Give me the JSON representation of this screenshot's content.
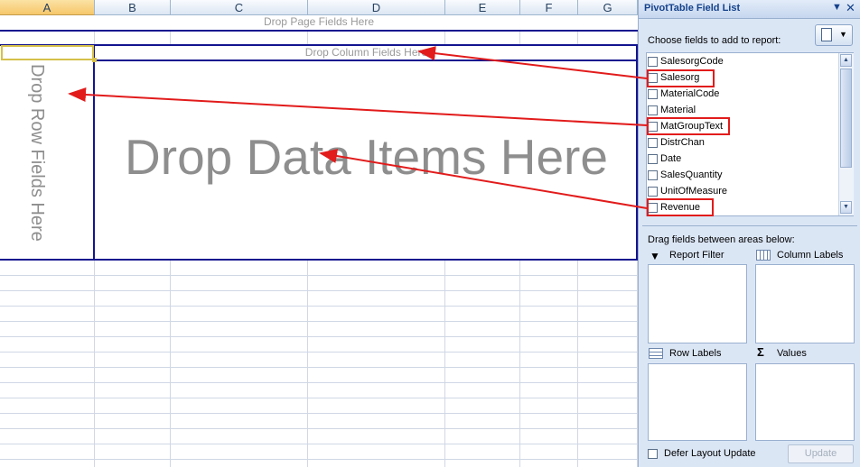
{
  "sheet": {
    "columns": [
      "A",
      "B",
      "C",
      "D",
      "E",
      "F",
      "G"
    ],
    "drop_page": "Drop Page Fields Here",
    "drop_column": "Drop Column Fields Here",
    "drop_row": "Drop Row Fields Here",
    "drop_data": "Drop Data Items Here"
  },
  "pane": {
    "title": "PivotTable Field List",
    "choose_label": "Choose fields to add to report:",
    "fields": [
      "SalesorgCode",
      "Salesorg",
      "MaterialCode",
      "Material",
      "MatGroupText",
      "DistrChan",
      "Date",
      "SalesQuantity",
      "UnitOfMeasure",
      "Revenue"
    ],
    "drag_label": "Drag fields between areas below:",
    "areas": {
      "report_filter": "Report Filter",
      "column_labels": "Column Labels",
      "row_labels": "Row Labels",
      "values": "Values"
    },
    "defer_label": "Defer Layout Update",
    "update_label": "Update"
  },
  "colors": {
    "pivot_border": "#13148f",
    "annotation": "#e21b1b",
    "pane_bg": "#dbe6f5"
  }
}
